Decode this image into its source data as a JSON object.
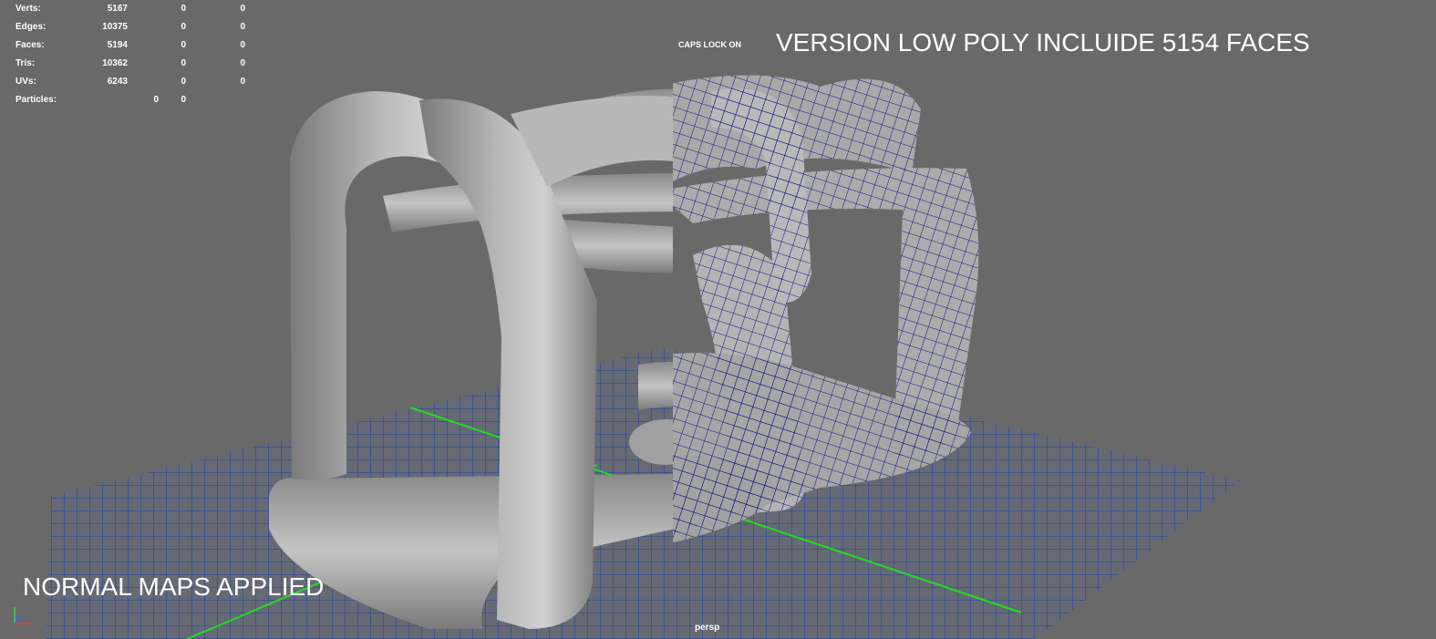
{
  "stats": {
    "rows": [
      {
        "label": "Verts:",
        "v1": "5167",
        "v2": "0",
        "v3": "0"
      },
      {
        "label": "Edges:",
        "v1": "10375",
        "v2": "0",
        "v3": "0"
      },
      {
        "label": "Faces:",
        "v1": "5194",
        "v2": "0",
        "v3": "0"
      },
      {
        "label": "Tris:",
        "v1": "10362",
        "v2": "0",
        "v3": "0"
      },
      {
        "label": "UVs:",
        "v1": "6243",
        "v2": "0",
        "v3": "0"
      }
    ],
    "particles": {
      "label": "Particles:",
      "v1": "0",
      "v2": "0"
    }
  },
  "caps_lock": "CAPS LOCK ON",
  "overlay_top": "VERSION LOW POLY INCLUIDE 5154 FACES",
  "overlay_bottom": "NORMAL MAPS APPLIED",
  "camera_name": "persp",
  "colors": {
    "background": "#696969",
    "grid": "#1f3fa8",
    "axis_lines": "#22dd22",
    "mesh_fill": "#a9a9a9",
    "wireframe": "#13137a"
  }
}
